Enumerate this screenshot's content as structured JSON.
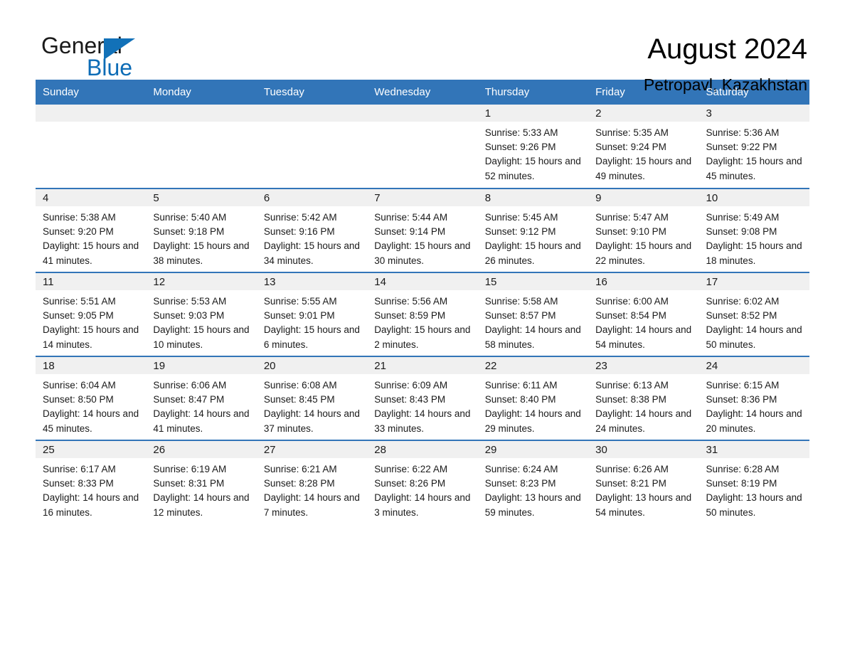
{
  "brand": {
    "name_part1": "General",
    "name_part2": "Blue",
    "triangle_color": "#1271b8",
    "blue_text_color": "#0d6cb6"
  },
  "header": {
    "month_title": "August 2024",
    "location": "Petropavl, Kazakhstan",
    "header_bar_color": "#3275b8",
    "row_divider_color": "#3275b8",
    "daynum_band_color": "#f0f0f0"
  },
  "weekdays": [
    "Sunday",
    "Monday",
    "Tuesday",
    "Wednesday",
    "Thursday",
    "Friday",
    "Saturday"
  ],
  "calendar": {
    "weeks": [
      [
        {
          "day": "",
          "empty": true
        },
        {
          "day": "",
          "empty": true
        },
        {
          "day": "",
          "empty": true
        },
        {
          "day": "",
          "empty": true
        },
        {
          "day": "1",
          "sunrise": "Sunrise: 5:33 AM",
          "sunset": "Sunset: 9:26 PM",
          "daylight": "Daylight: 15 hours and 52 minutes."
        },
        {
          "day": "2",
          "sunrise": "Sunrise: 5:35 AM",
          "sunset": "Sunset: 9:24 PM",
          "daylight": "Daylight: 15 hours and 49 minutes."
        },
        {
          "day": "3",
          "sunrise": "Sunrise: 5:36 AM",
          "sunset": "Sunset: 9:22 PM",
          "daylight": "Daylight: 15 hours and 45 minutes."
        }
      ],
      [
        {
          "day": "4",
          "sunrise": "Sunrise: 5:38 AM",
          "sunset": "Sunset: 9:20 PM",
          "daylight": "Daylight: 15 hours and 41 minutes."
        },
        {
          "day": "5",
          "sunrise": "Sunrise: 5:40 AM",
          "sunset": "Sunset: 9:18 PM",
          "daylight": "Daylight: 15 hours and 38 minutes."
        },
        {
          "day": "6",
          "sunrise": "Sunrise: 5:42 AM",
          "sunset": "Sunset: 9:16 PM",
          "daylight": "Daylight: 15 hours and 34 minutes."
        },
        {
          "day": "7",
          "sunrise": "Sunrise: 5:44 AM",
          "sunset": "Sunset: 9:14 PM",
          "daylight": "Daylight: 15 hours and 30 minutes."
        },
        {
          "day": "8",
          "sunrise": "Sunrise: 5:45 AM",
          "sunset": "Sunset: 9:12 PM",
          "daylight": "Daylight: 15 hours and 26 minutes."
        },
        {
          "day": "9",
          "sunrise": "Sunrise: 5:47 AM",
          "sunset": "Sunset: 9:10 PM",
          "daylight": "Daylight: 15 hours and 22 minutes."
        },
        {
          "day": "10",
          "sunrise": "Sunrise: 5:49 AM",
          "sunset": "Sunset: 9:08 PM",
          "daylight": "Daylight: 15 hours and 18 minutes."
        }
      ],
      [
        {
          "day": "11",
          "sunrise": "Sunrise: 5:51 AM",
          "sunset": "Sunset: 9:05 PM",
          "daylight": "Daylight: 15 hours and 14 minutes."
        },
        {
          "day": "12",
          "sunrise": "Sunrise: 5:53 AM",
          "sunset": "Sunset: 9:03 PM",
          "daylight": "Daylight: 15 hours and 10 minutes."
        },
        {
          "day": "13",
          "sunrise": "Sunrise: 5:55 AM",
          "sunset": "Sunset: 9:01 PM",
          "daylight": "Daylight: 15 hours and 6 minutes."
        },
        {
          "day": "14",
          "sunrise": "Sunrise: 5:56 AM",
          "sunset": "Sunset: 8:59 PM",
          "daylight": "Daylight: 15 hours and 2 minutes."
        },
        {
          "day": "15",
          "sunrise": "Sunrise: 5:58 AM",
          "sunset": "Sunset: 8:57 PM",
          "daylight": "Daylight: 14 hours and 58 minutes."
        },
        {
          "day": "16",
          "sunrise": "Sunrise: 6:00 AM",
          "sunset": "Sunset: 8:54 PM",
          "daylight": "Daylight: 14 hours and 54 minutes."
        },
        {
          "day": "17",
          "sunrise": "Sunrise: 6:02 AM",
          "sunset": "Sunset: 8:52 PM",
          "daylight": "Daylight: 14 hours and 50 minutes."
        }
      ],
      [
        {
          "day": "18",
          "sunrise": "Sunrise: 6:04 AM",
          "sunset": "Sunset: 8:50 PM",
          "daylight": "Daylight: 14 hours and 45 minutes."
        },
        {
          "day": "19",
          "sunrise": "Sunrise: 6:06 AM",
          "sunset": "Sunset: 8:47 PM",
          "daylight": "Daylight: 14 hours and 41 minutes."
        },
        {
          "day": "20",
          "sunrise": "Sunrise: 6:08 AM",
          "sunset": "Sunset: 8:45 PM",
          "daylight": "Daylight: 14 hours and 37 minutes."
        },
        {
          "day": "21",
          "sunrise": "Sunrise: 6:09 AM",
          "sunset": "Sunset: 8:43 PM",
          "daylight": "Daylight: 14 hours and 33 minutes."
        },
        {
          "day": "22",
          "sunrise": "Sunrise: 6:11 AM",
          "sunset": "Sunset: 8:40 PM",
          "daylight": "Daylight: 14 hours and 29 minutes."
        },
        {
          "day": "23",
          "sunrise": "Sunrise: 6:13 AM",
          "sunset": "Sunset: 8:38 PM",
          "daylight": "Daylight: 14 hours and 24 minutes."
        },
        {
          "day": "24",
          "sunrise": "Sunrise: 6:15 AM",
          "sunset": "Sunset: 8:36 PM",
          "daylight": "Daylight: 14 hours and 20 minutes."
        }
      ],
      [
        {
          "day": "25",
          "sunrise": "Sunrise: 6:17 AM",
          "sunset": "Sunset: 8:33 PM",
          "daylight": "Daylight: 14 hours and 16 minutes."
        },
        {
          "day": "26",
          "sunrise": "Sunrise: 6:19 AM",
          "sunset": "Sunset: 8:31 PM",
          "daylight": "Daylight: 14 hours and 12 minutes."
        },
        {
          "day": "27",
          "sunrise": "Sunrise: 6:21 AM",
          "sunset": "Sunset: 8:28 PM",
          "daylight": "Daylight: 14 hours and 7 minutes."
        },
        {
          "day": "28",
          "sunrise": "Sunrise: 6:22 AM",
          "sunset": "Sunset: 8:26 PM",
          "daylight": "Daylight: 14 hours and 3 minutes."
        },
        {
          "day": "29",
          "sunrise": "Sunrise: 6:24 AM",
          "sunset": "Sunset: 8:23 PM",
          "daylight": "Daylight: 13 hours and 59 minutes."
        },
        {
          "day": "30",
          "sunrise": "Sunrise: 6:26 AM",
          "sunset": "Sunset: 8:21 PM",
          "daylight": "Daylight: 13 hours and 54 minutes."
        },
        {
          "day": "31",
          "sunrise": "Sunrise: 6:28 AM",
          "sunset": "Sunset: 8:19 PM",
          "daylight": "Daylight: 13 hours and 50 minutes."
        }
      ]
    ]
  }
}
